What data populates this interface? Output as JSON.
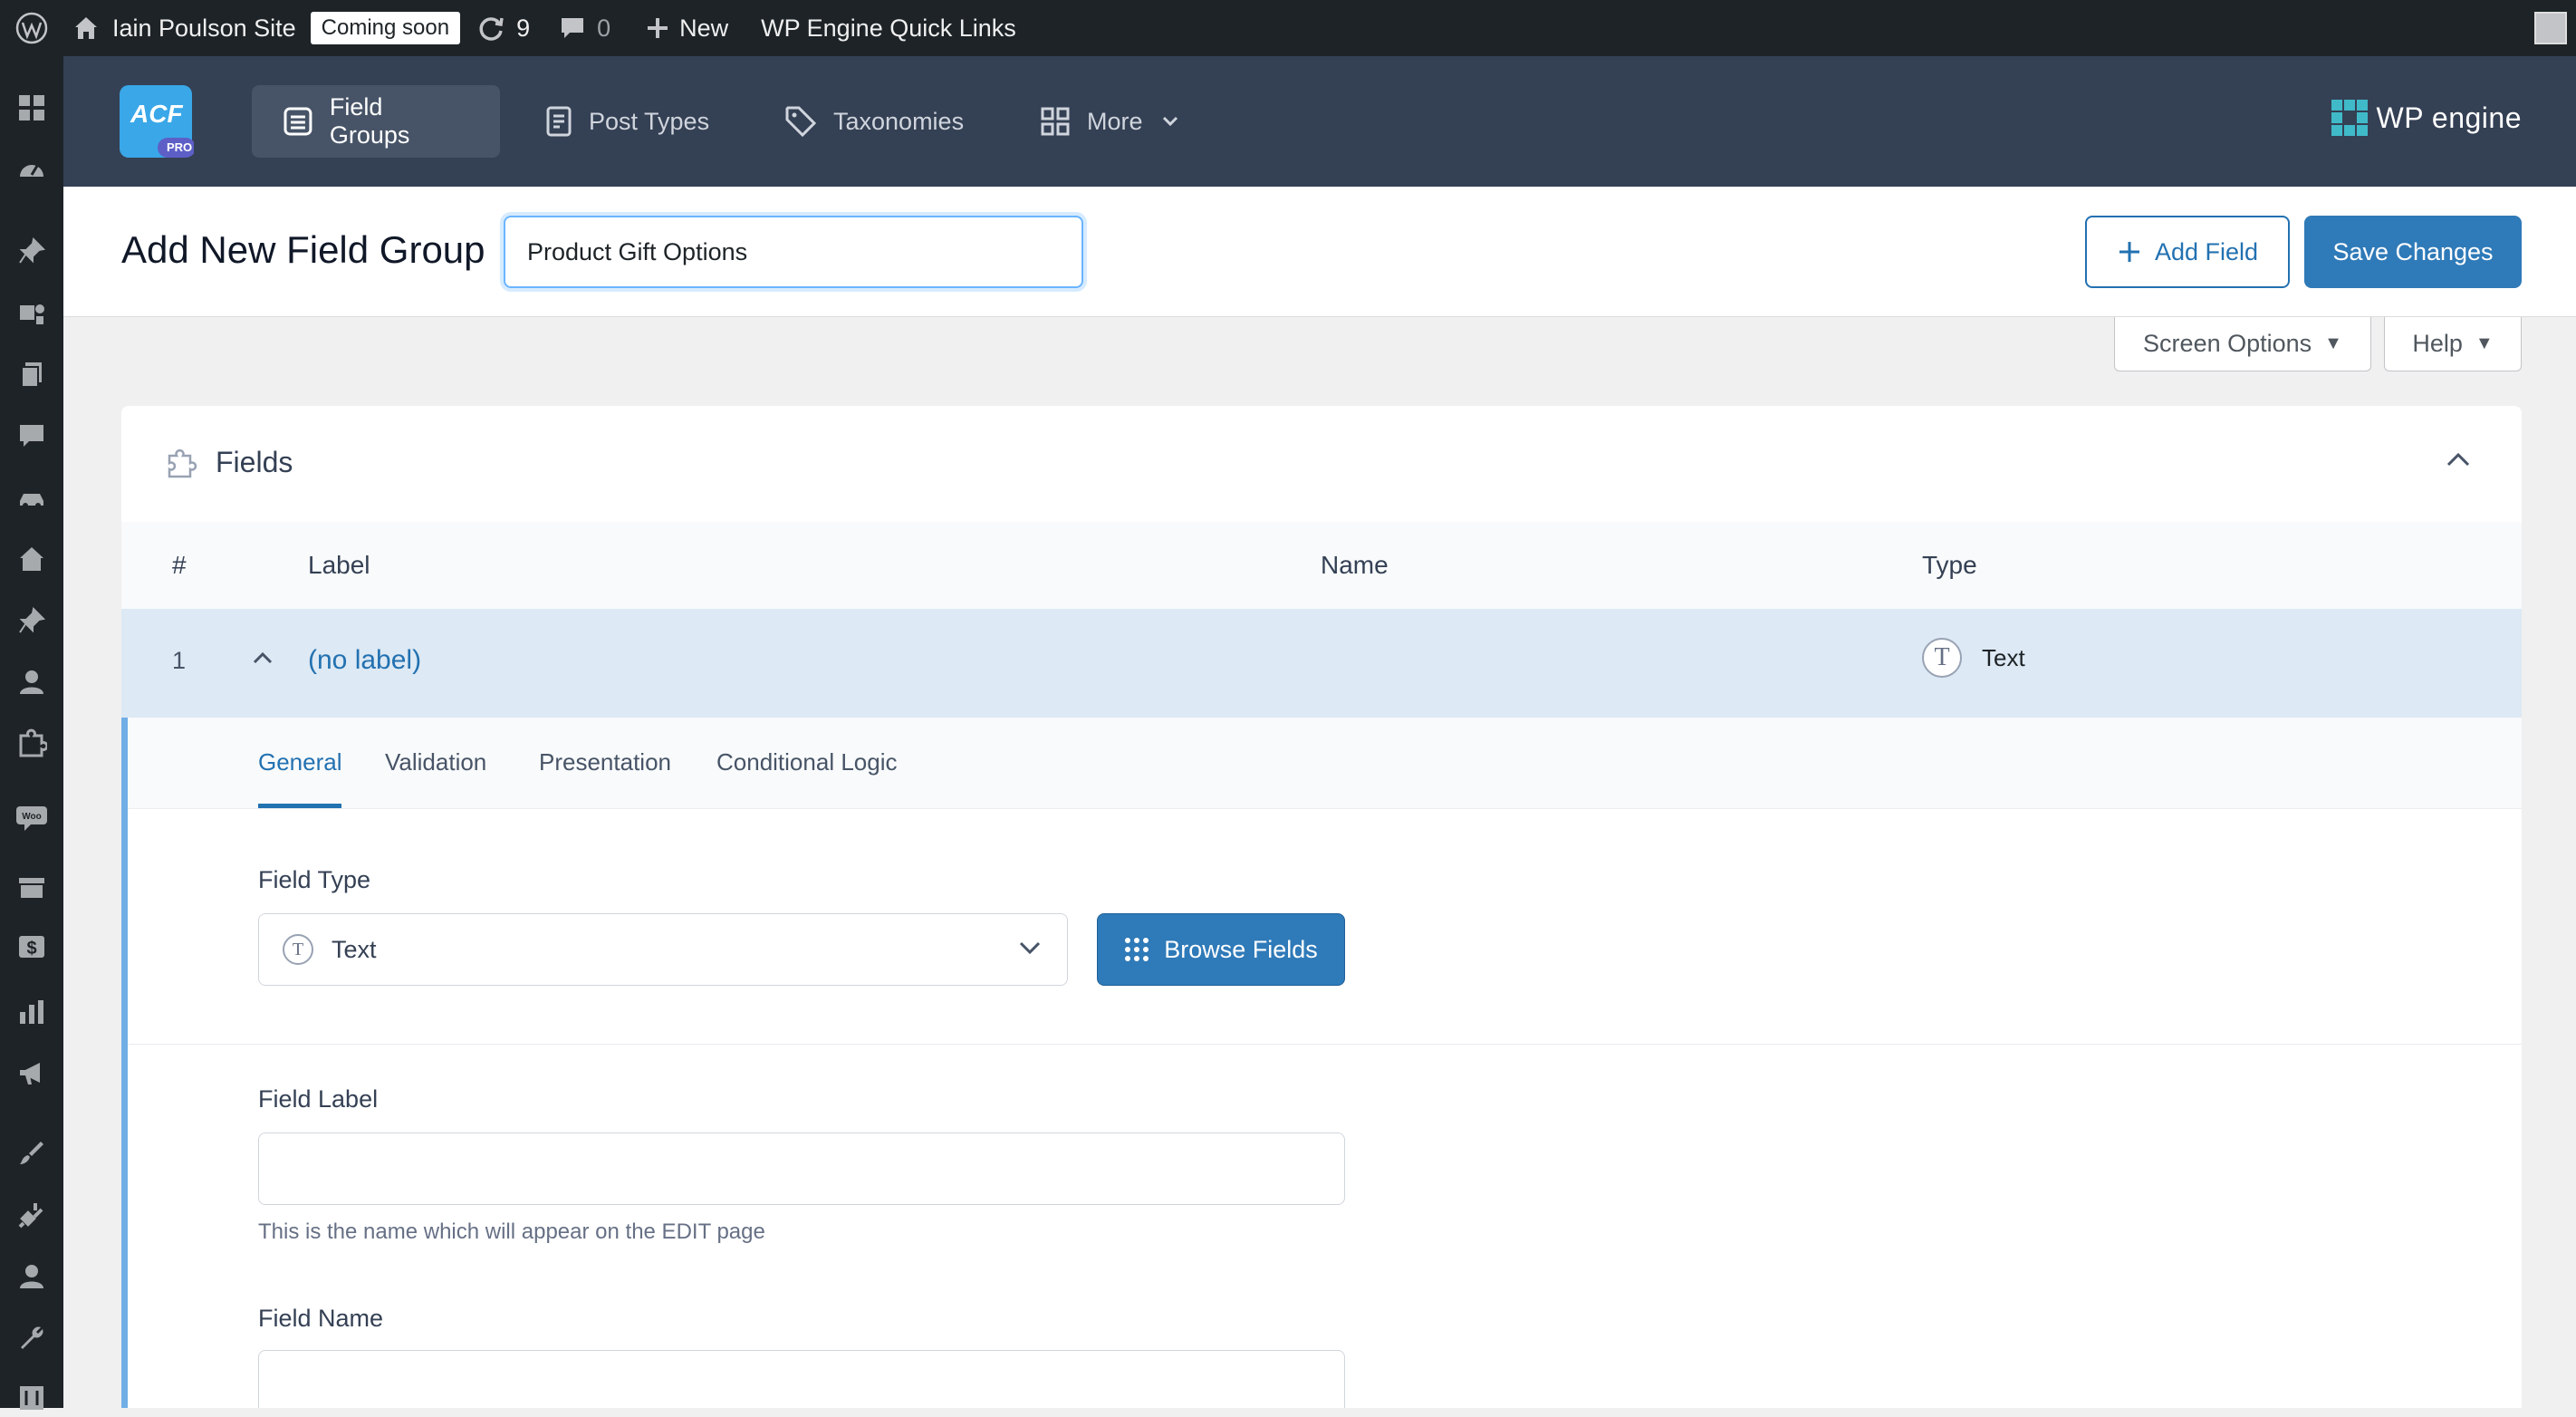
{
  "adminbar": {
    "site_name": "Iain Poulson Site",
    "coming_soon": "Coming soon",
    "updates_count": "9",
    "comments_count": "0",
    "new_label": "New",
    "quick_links": "WP Engine Quick Links"
  },
  "acf_nav": {
    "logo_text": "ACF",
    "logo_badge": "PRO",
    "items": [
      {
        "label": "Field Groups",
        "active": true
      },
      {
        "label": "Post Types"
      },
      {
        "label": "Taxonomies"
      },
      {
        "label": "More"
      }
    ],
    "brand": "WP engine"
  },
  "titlebar": {
    "title": "Add New Field Group",
    "group_title_value": "Product Gift Options",
    "add_field_label": "Add Field",
    "save_label": "Save Changes"
  },
  "screen_meta": {
    "screen_options": "Screen Options",
    "help": "Help"
  },
  "fields_panel": {
    "title": "Fields",
    "columns": [
      "#",
      "Label",
      "Name",
      "Type"
    ],
    "rows": [
      {
        "num": "1",
        "label": "(no label)",
        "name": "",
        "type": "Text"
      }
    ],
    "tabs": [
      "General",
      "Validation",
      "Presentation",
      "Conditional Logic"
    ],
    "field_type_label": "Field Type",
    "field_type_value": "Text",
    "browse_fields": "Browse Fields",
    "field_label_label": "Field Label",
    "field_label_value": "",
    "field_label_help": "This is the name which will appear on the EDIT page",
    "field_name_label": "Field Name",
    "field_name_value": ""
  },
  "colors": {
    "admin_bg": "#1d2327",
    "acf_header": "#344054",
    "primary": "#2271b1",
    "selected_row": "#dde9f4"
  }
}
